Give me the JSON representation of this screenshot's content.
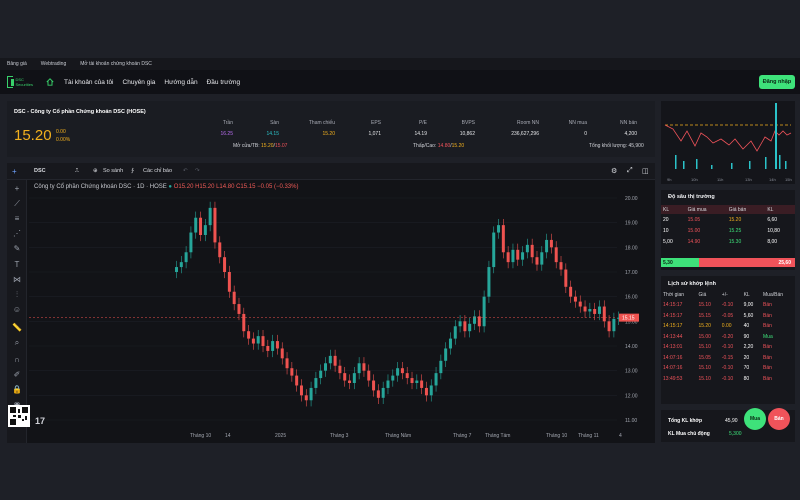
{
  "links": [
    "Bảng giá",
    "Webtrading",
    "Mở tài khoản chứng khoán DSC"
  ],
  "logo_text": [
    "DSC",
    "Securities"
  ],
  "nav": [
    "Tài khoản của tôi",
    "Chuyên gia",
    "Hướng dẫn",
    "Đầu trường"
  ],
  "login": "Đăng nhập",
  "quote": {
    "title": "DSC - Công ty Cổ phần Chứng khoán DSC (HOSE)",
    "price": "15.20",
    "change": "0.00",
    "change_pct": "0.00%",
    "columns": [
      {
        "label": "Trần",
        "value": "16.25",
        "color": "#b86df0"
      },
      {
        "label": "Sàn",
        "value": "14.15",
        "color": "#2bc3c9"
      },
      {
        "label": "Tham chiếu",
        "value": "15.20",
        "color": "#f2b01e"
      },
      {
        "label": "EPS",
        "value": "1,071",
        "color": "#e6e7ea"
      },
      {
        "label": "P/E",
        "value": "14.19",
        "color": "#e6e7ea"
      },
      {
        "label": "BVPS",
        "value": "10,862",
        "color": "#e6e7ea"
      },
      {
        "label": "Room NN",
        "value": "236,627,296",
        "color": "#e6e7ea"
      },
      {
        "label": "NN mua",
        "value": "0",
        "color": "#e6e7ea"
      },
      {
        "label": "NN bán",
        "value": "4,200",
        "color": "#e6e7ea"
      }
    ],
    "open_avg_label": "Mở cửa/TB:",
    "open_val": "15.20",
    "avg_val": "15.07",
    "hl_label": "Thấp/Cao:",
    "low_val": "14.80",
    "high_val": "15.20",
    "volume_label": "Tổng khối lượng:",
    "volume_val": "45,900"
  },
  "toolbar": {
    "symbol": "DSC",
    "compare": "So sánh",
    "indicators": "Các chỉ báo"
  },
  "legend": {
    "name": "Công ty Cổ phần Chứng khoán DSC · 1D · HOSE",
    "ohlc": "O15.20 H15.20 L14.80 C15.15 −0.05 (−0.33%)"
  },
  "chart_data": {
    "type": "candlestick",
    "title": "Công ty Cổ phần Chứng khoán DSC · 1D · HOSE",
    "ylim": [
      11,
      20
    ],
    "yticks": [
      "20.00",
      "19.00",
      "18.00",
      "17.00",
      "16.00",
      "15.00",
      "14.00",
      "13.00",
      "12.00",
      "11.00"
    ],
    "xticks": [
      "Tháng 10",
      "14",
      "2025",
      "Tháng 3",
      "Tháng Năm",
      "Tháng 7",
      "Tháng Tám",
      "Tháng 10",
      "Tháng 11",
      "4"
    ],
    "last_price_label": "15.15",
    "series": [
      {
        "name": "close",
        "values": [
          17.2,
          17.4,
          17.8,
          18.6,
          19.2,
          18.5,
          18.9,
          19.6,
          18.2,
          17.6,
          17.0,
          16.2,
          15.7,
          15.3,
          14.6,
          14.3,
          14.1,
          14.4,
          14.0,
          13.8,
          14.2,
          13.9,
          13.5,
          13.1,
          12.8,
          12.4,
          12.0,
          11.8,
          12.3,
          12.7,
          13.0,
          13.3,
          13.6,
          13.2,
          12.9,
          12.6,
          12.5,
          12.9,
          13.3,
          13.0,
          12.6,
          12.2,
          11.9,
          12.3,
          12.6,
          12.8,
          13.1,
          12.9,
          12.7,
          12.5,
          12.6,
          12.3,
          12.0,
          12.4,
          12.9,
          13.4,
          13.9,
          14.3,
          14.8,
          15.0,
          14.6,
          14.9,
          15.2,
          14.8,
          16.0,
          17.2,
          18.6,
          18.9,
          17.8,
          17.4,
          17.9,
          17.5,
          17.8,
          18.1,
          17.6,
          17.3,
          17.8,
          18.3,
          18.0,
          17.4,
          17.1,
          16.4,
          16.0,
          15.8,
          15.6,
          15.4,
          15.5,
          15.3,
          15.6,
          15.0,
          14.6,
          15.1,
          15.15
        ]
      }
    ]
  },
  "mini_chart": {
    "ref": "15.20"
  },
  "depth": {
    "title": "Độ sâu thị trường",
    "headers": [
      "KL",
      "Giá mua",
      "Giá bán",
      "KL"
    ],
    "rows": [
      {
        "kl_mua": "20",
        "gia_mua": "15.05",
        "gia_ban": "15.20",
        "kl_ban": "6,60"
      },
      {
        "kl_mua": "10",
        "gia_mua": "15.00",
        "gia_ban": "15.25",
        "kl_ban": "10,80"
      },
      {
        "kl_mua": "5,00",
        "gia_mua": "14.90",
        "gia_ban": "15.30",
        "kl_ban": "8,00"
      }
    ],
    "buy_total": "5,30",
    "sell_total": "25,60"
  },
  "history": {
    "title": "Lịch sử khớp lệnh",
    "headers": [
      "Thời gian",
      "Giá",
      "+/-",
      "KL",
      "Mua/Bán"
    ],
    "rows": [
      {
        "t": "14:15:17",
        "p": "15.10",
        "d": "-0.10",
        "kl": "9,00",
        "s": "Bán",
        "c": "#f0535a",
        "sc": "#f0535a"
      },
      {
        "t": "14:15:17",
        "p": "15.15",
        "d": "-0.05",
        "kl": "5,60",
        "s": "Bán",
        "c": "#f0535a",
        "sc": "#f0535a"
      },
      {
        "t": "14:15:17",
        "p": "15.20",
        "d": "0.00",
        "kl": "40",
        "s": "Bán",
        "c": "#f2b01e",
        "sc": "#f0535a"
      },
      {
        "t": "14:13:44",
        "p": "15.00",
        "d": "-0.20",
        "kl": "90",
        "s": "Mua",
        "c": "#f0535a",
        "sc": "#3ee27a"
      },
      {
        "t": "14:13:01",
        "p": "15.10",
        "d": "-0.10",
        "kl": "2,20",
        "s": "Bán",
        "c": "#f0535a",
        "sc": "#f0535a"
      },
      {
        "t": "14:07:16",
        "p": "15.05",
        "d": "-0.15",
        "kl": "20",
        "s": "Bán",
        "c": "#f0535a",
        "sc": "#f0535a"
      },
      {
        "t": "14:07:16",
        "p": "15.10",
        "d": "-0.10",
        "kl": "70",
        "s": "Bán",
        "c": "#f0535a",
        "sc": "#f0535a"
      },
      {
        "t": "13:49:53",
        "p": "15.10",
        "d": "-0.10",
        "kl": "80",
        "s": "Bán",
        "c": "#f0535a",
        "sc": "#f0535a"
      }
    ]
  },
  "totals": {
    "match_label": "Tổng KL khớp",
    "match_val": "45,90",
    "buy_label": "KL Mua chủ động",
    "buy_val": "5,300"
  },
  "buy_btn": "Mua",
  "sell_btn": "Bán",
  "colors": {
    "up": "#26a69a",
    "down": "#ef5350",
    "ref": "#f2b01e",
    "accent": "#3ee27a"
  }
}
